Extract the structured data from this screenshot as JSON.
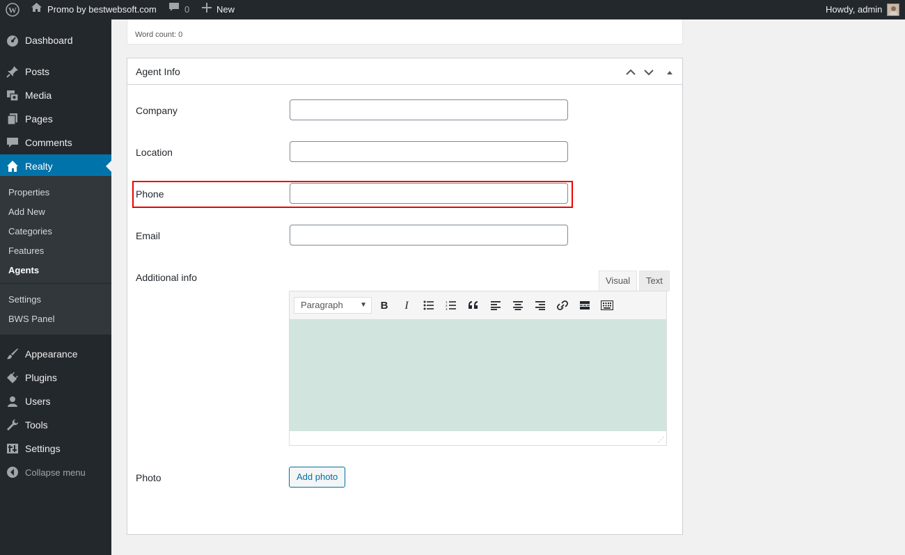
{
  "adminbar": {
    "site_name": "Promo by bestwebsoft.com",
    "comments_count": "0",
    "new_label": "New",
    "howdy": "Howdy, admin"
  },
  "sidebar": {
    "items": [
      {
        "label": "Dashboard",
        "icon": "dashboard-icon"
      },
      {
        "label": "Posts",
        "icon": "pin-icon"
      },
      {
        "label": "Media",
        "icon": "media-icon"
      },
      {
        "label": "Pages",
        "icon": "pages-icon"
      },
      {
        "label": "Comments",
        "icon": "comment-icon"
      },
      {
        "label": "Realty",
        "icon": "home-icon"
      },
      {
        "label": "Appearance",
        "icon": "brush-icon"
      },
      {
        "label": "Plugins",
        "icon": "plug-icon"
      },
      {
        "label": "Users",
        "icon": "user-icon"
      },
      {
        "label": "Tools",
        "icon": "wrench-icon"
      },
      {
        "label": "Settings",
        "icon": "settings-icon"
      },
      {
        "label": "Collapse menu",
        "icon": "collapse-icon"
      }
    ],
    "submenu": [
      "Properties",
      "Add New",
      "Categories",
      "Features",
      "Agents",
      "Settings",
      "BWS Panel"
    ]
  },
  "wordcount": "Word count: 0",
  "postbox": {
    "title": "Agent Info",
    "fields": {
      "company": {
        "label": "Company",
        "value": ""
      },
      "location": {
        "label": "Location",
        "value": ""
      },
      "phone": {
        "label": "Phone",
        "value": ""
      },
      "email": {
        "label": "Email",
        "value": ""
      },
      "additional": {
        "label": "Additional info"
      },
      "photo": {
        "label": "Photo"
      }
    },
    "tabs": {
      "visual": "Visual",
      "text": "Text"
    },
    "format_select": "Paragraph",
    "add_photo": "Add photo"
  },
  "colors": {
    "adminbar": "#23282d",
    "accent": "#0073aa",
    "highlight": "#ee0000",
    "editor_bg": "#d2e4de"
  }
}
